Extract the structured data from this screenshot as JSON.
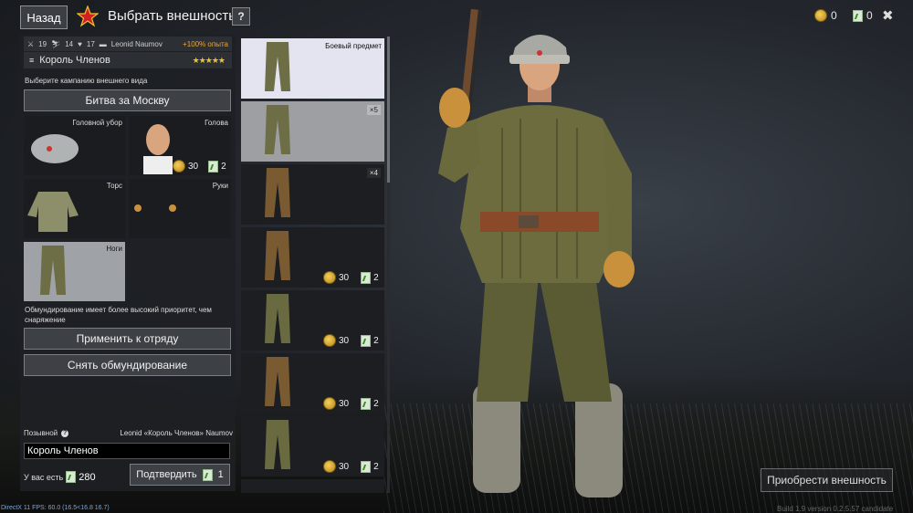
{
  "top": {
    "back_label": "Назад",
    "title": "Выбрать внешность",
    "help_label": "?",
    "gold": "0",
    "tickets": "0",
    "close": "✖"
  },
  "profile": {
    "stat1": "19",
    "stat2": "14",
    "stat3": "17",
    "player": "Leonid Naumov",
    "bonus": "+100% опыта",
    "squad_name": "Король Членов",
    "rating": "★★★★★"
  },
  "campaign": {
    "label": "Выберите кампанию внешнего вида",
    "value": "Битва за Москву"
  },
  "slots": [
    {
      "label": "Головной убор"
    },
    {
      "label": "Голова",
      "gold": "30",
      "tickets": "2"
    },
    {
      "label": "Торс"
    },
    {
      "label": "Руки"
    },
    {
      "label": "Ноги"
    }
  ],
  "note": "Обмундирование имеет более высокий приоритет, чем снаряжение",
  "buttons": {
    "apply": "Применить к отряду",
    "remove": "Снять обмундирование",
    "confirm": "Подтвердить",
    "confirm_cost": "1",
    "buy": "Приобрести внешность"
  },
  "callsign": {
    "label": "Позывной",
    "full_name": "Leonid «Король Членов» Naumov",
    "value": "Король Членов",
    "have_label": "У вас есть",
    "have_value": "280"
  },
  "items": [
    {
      "tag": "Боевый предмет"
    },
    {
      "qty": "×5"
    },
    {
      "qty": "×4"
    },
    {
      "gold": "30",
      "tickets": "2"
    },
    {
      "gold": "30",
      "tickets": "2"
    },
    {
      "gold": "30",
      "tickets": "2"
    },
    {
      "gold": "30",
      "tickets": "2"
    }
  ],
  "footer": {
    "fps": "DirectX 11 FPS: 60.0 (16.5<16.8 16.7)",
    "version": "Build 1.9 version 0.2.5.57 candidate"
  },
  "colors": {
    "accent_gold": "#f2c12e",
    "bonus_orange": "#e8a63a",
    "uniform": "#6b6a3a"
  }
}
